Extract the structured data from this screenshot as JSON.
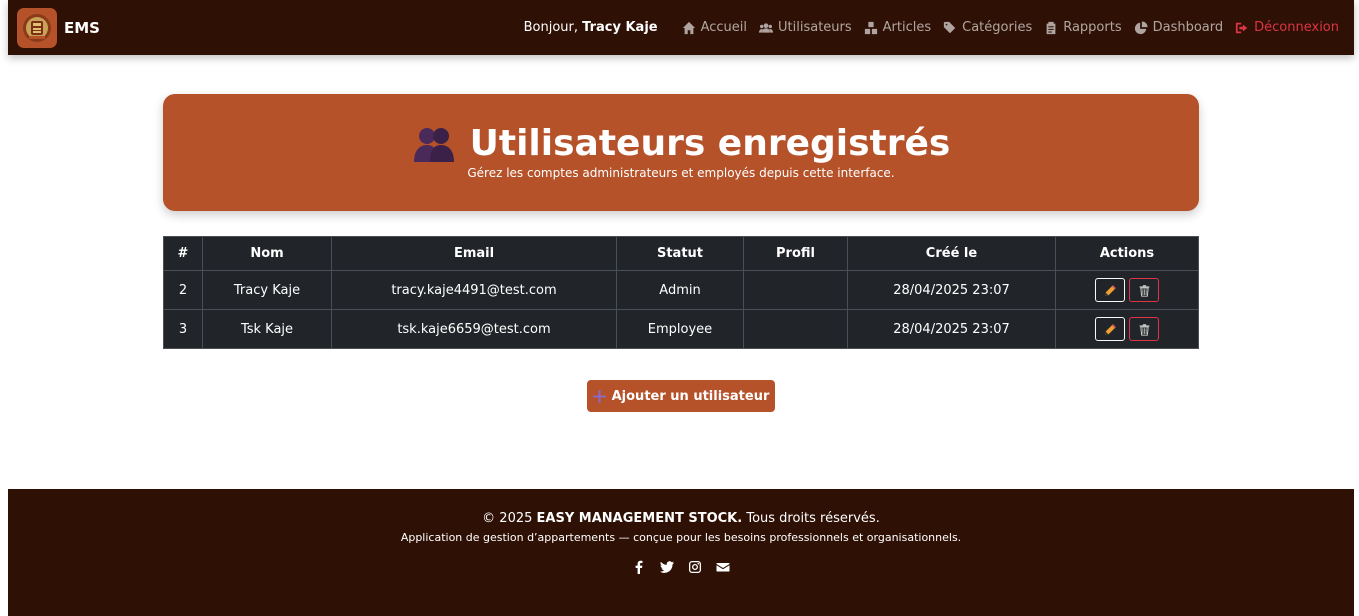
{
  "navbar": {
    "brand": "EMS",
    "greeting_prefix": "Bonjour,",
    "user_name": "Tracy Kaje",
    "items": [
      {
        "label": "Accueil",
        "icon": "home-icon"
      },
      {
        "label": "Utilisateurs",
        "icon": "users-icon"
      },
      {
        "label": "Articles",
        "icon": "boxes-icon"
      },
      {
        "label": "Catégories",
        "icon": "tags-icon"
      },
      {
        "label": "Rapports",
        "icon": "clipboard-icon"
      },
      {
        "label": "Dashboard",
        "icon": "chart-pie-icon"
      }
    ],
    "logout": {
      "label": "Déconnexion",
      "icon": "sign-out-icon"
    }
  },
  "hero": {
    "title": "Utilisateurs enregistrés",
    "subtitle": "Gérez les comptes administrateurs et employés depuis cette interface."
  },
  "table": {
    "headers": [
      "#",
      "Nom",
      "Email",
      "Statut",
      "Profil",
      "Créé le",
      "Actions"
    ],
    "rows": [
      {
        "id": "2",
        "name": "Tracy Kaje",
        "email": "tracy.kaje4491@test.com",
        "status": "Admin",
        "profile": "",
        "created": "28/04/2025 23:07"
      },
      {
        "id": "3",
        "name": "Tsk Kaje",
        "email": "tsk.kaje6659@test.com",
        "status": "Employee",
        "profile": "",
        "created": "28/04/2025 23:07"
      }
    ]
  },
  "add_button": {
    "label": "Ajouter un utilisateur"
  },
  "footer": {
    "copyright_prefix": "© 2025",
    "company": "EASY MANAGEMENT STOCK.",
    "rights": "Tous droits réservés.",
    "tagline": "Application de gestion d’appartements — conçue pour les besoins professionnels et organisationnels.",
    "socials": [
      "facebook-icon",
      "twitter-icon",
      "instagram-icon",
      "envelope-icon"
    ]
  },
  "colors": {
    "navbar_bg": "#2e1005",
    "accent": "#b5522a",
    "table_bg": "#212529",
    "danger": "#dc3545"
  }
}
